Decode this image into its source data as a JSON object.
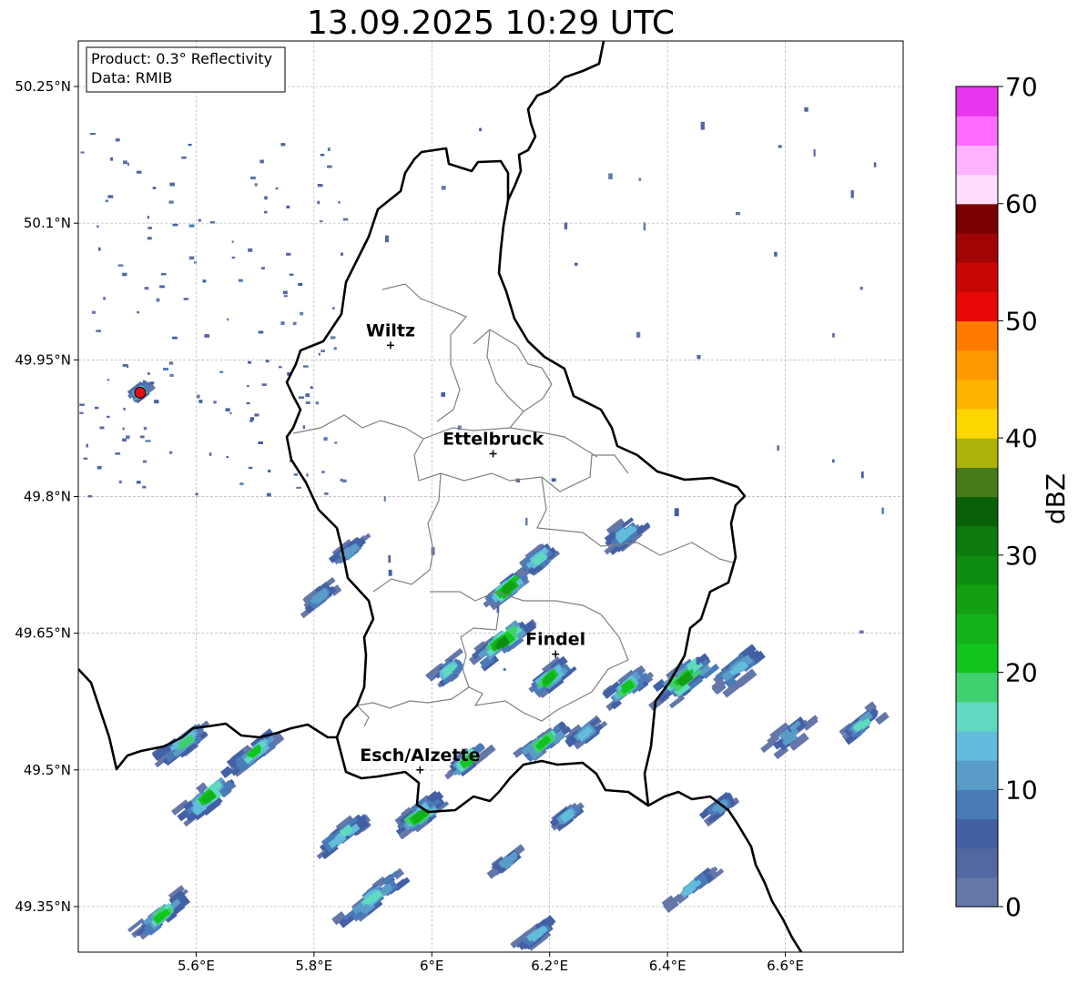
{
  "title": "13.09.2025 10:29 UTC",
  "info_box": {
    "product": "Product: 0.3° Reflectivity",
    "data": "Data: RMIB"
  },
  "map": {
    "lon_range": [
      5.4,
      6.8
    ],
    "lat_range": [
      49.3,
      50.3
    ],
    "x_ticks": [
      {
        "lon": 5.6,
        "label": "5.6°E"
      },
      {
        "lon": 5.8,
        "label": "5.8°E"
      },
      {
        "lon": 6.0,
        "label": "6°E"
      },
      {
        "lon": 6.2,
        "label": "6.2°E"
      },
      {
        "lon": 6.4,
        "label": "6.4°E"
      },
      {
        "lon": 6.6,
        "label": "6.6°E"
      }
    ],
    "y_ticks": [
      {
        "lat": 50.25,
        "label": "50.25°N"
      },
      {
        "lat": 50.1,
        "label": "50.1°N"
      },
      {
        "lat": 49.95,
        "label": "49.95°N"
      },
      {
        "lat": 49.8,
        "label": "49.8°N"
      },
      {
        "lat": 49.65,
        "label": "49.65°N"
      },
      {
        "lat": 49.5,
        "label": "49.5°N"
      },
      {
        "lat": 49.35,
        "label": "49.35°N"
      }
    ],
    "grid": true,
    "cities": [
      {
        "name": "Wiltz",
        "lon": 5.93,
        "lat": 49.966
      },
      {
        "name": "Ettelbruck",
        "lon": 6.104,
        "lat": 49.847
      },
      {
        "name": "Findel",
        "lon": 6.21,
        "lat": 49.627
      },
      {
        "name": "Esch/Alzette",
        "lon": 5.98,
        "lat": 49.5
      }
    ],
    "radar_site": {
      "lon": 5.505,
      "lat": 49.914,
      "color": "#e01010"
    }
  },
  "colorbar": {
    "label": "dBZ",
    "ticks": [
      0,
      10,
      20,
      30,
      40,
      50,
      60,
      70
    ],
    "colors": [
      "#6477a8",
      "#5368a0",
      "#4360a5",
      "#4a7bb8",
      "#5a9cc8",
      "#62bcdc",
      "#5fd9c0",
      "#3fd070",
      "#12c41e",
      "#12b218",
      "#12a012",
      "#0e8c10",
      "#0c7a0c",
      "#096009",
      "#487a18",
      "#acb20a",
      "#ffd700",
      "#ffb400",
      "#ff9a00",
      "#ff7a00",
      "#e80808",
      "#c80606",
      "#a00404",
      "#7a0000",
      "#ffdcff",
      "#ffb2ff",
      "#ff6cff",
      "#e834ec"
    ]
  },
  "cells": [
    {
      "lon": 6.13,
      "lat": 49.7,
      "len": 0.09,
      "wid": 0.03,
      "peak": 26
    },
    {
      "lon": 6.12,
      "lat": 49.64,
      "len": 0.11,
      "wid": 0.035,
      "peak": 28
    },
    {
      "lon": 6.2,
      "lat": 49.6,
      "len": 0.07,
      "wid": 0.03,
      "peak": 24
    },
    {
      "lon": 6.19,
      "lat": 49.53,
      "len": 0.09,
      "wid": 0.03,
      "peak": 22
    },
    {
      "lon": 6.43,
      "lat": 49.6,
      "len": 0.12,
      "wid": 0.05,
      "peak": 25
    },
    {
      "lon": 6.33,
      "lat": 49.59,
      "len": 0.08,
      "wid": 0.03,
      "peak": 21
    },
    {
      "lon": 6.06,
      "lat": 49.51,
      "len": 0.07,
      "wid": 0.03,
      "peak": 22
    },
    {
      "lon": 5.98,
      "lat": 49.45,
      "len": 0.09,
      "wid": 0.035,
      "peak": 24
    },
    {
      "lon": 5.62,
      "lat": 49.47,
      "len": 0.12,
      "wid": 0.04,
      "peak": 23
    },
    {
      "lon": 5.58,
      "lat": 49.53,
      "len": 0.1,
      "wid": 0.03,
      "peak": 18
    },
    {
      "lon": 5.7,
      "lat": 49.52,
      "len": 0.09,
      "wid": 0.03,
      "peak": 20
    },
    {
      "lon": 5.85,
      "lat": 49.43,
      "len": 0.1,
      "wid": 0.03,
      "peak": 16
    },
    {
      "lon": 5.9,
      "lat": 49.36,
      "len": 0.14,
      "wid": 0.035,
      "peak": 17
    },
    {
      "lon": 5.54,
      "lat": 49.34,
      "len": 0.1,
      "wid": 0.03,
      "peak": 22
    },
    {
      "lon": 6.03,
      "lat": 49.61,
      "len": 0.05,
      "wid": 0.03,
      "peak": 16
    },
    {
      "lon": 6.33,
      "lat": 49.76,
      "len": 0.08,
      "wid": 0.04,
      "peak": 13
    },
    {
      "lon": 6.18,
      "lat": 49.73,
      "len": 0.06,
      "wid": 0.03,
      "peak": 16
    },
    {
      "lon": 6.52,
      "lat": 49.61,
      "len": 0.1,
      "wid": 0.04,
      "peak": 14
    },
    {
      "lon": 6.61,
      "lat": 49.54,
      "len": 0.09,
      "wid": 0.04,
      "peak": 10
    },
    {
      "lon": 6.73,
      "lat": 49.55,
      "len": 0.07,
      "wid": 0.03,
      "peak": 15
    },
    {
      "lon": 6.26,
      "lat": 49.54,
      "len": 0.05,
      "wid": 0.025,
      "peak": 14
    },
    {
      "lon": 6.49,
      "lat": 49.46,
      "len": 0.06,
      "wid": 0.025,
      "peak": 12
    },
    {
      "lon": 6.44,
      "lat": 49.37,
      "len": 0.09,
      "wid": 0.02,
      "peak": 13
    },
    {
      "lon": 6.13,
      "lat": 49.4,
      "len": 0.05,
      "wid": 0.02,
      "peak": 10
    },
    {
      "lon": 6.23,
      "lat": 49.45,
      "len": 0.05,
      "wid": 0.02,
      "peak": 14
    },
    {
      "lon": 6.18,
      "lat": 49.32,
      "len": 0.07,
      "wid": 0.025,
      "peak": 13
    },
    {
      "lon": 5.81,
      "lat": 49.69,
      "len": 0.06,
      "wid": 0.02,
      "peak": 12
    },
    {
      "lon": 5.86,
      "lat": 49.74,
      "len": 0.06,
      "wid": 0.02,
      "peak": 12
    },
    {
      "lon": 5.505,
      "lat": 49.914,
      "len": 0.02,
      "wid": 0.02,
      "peak": 15
    }
  ]
}
